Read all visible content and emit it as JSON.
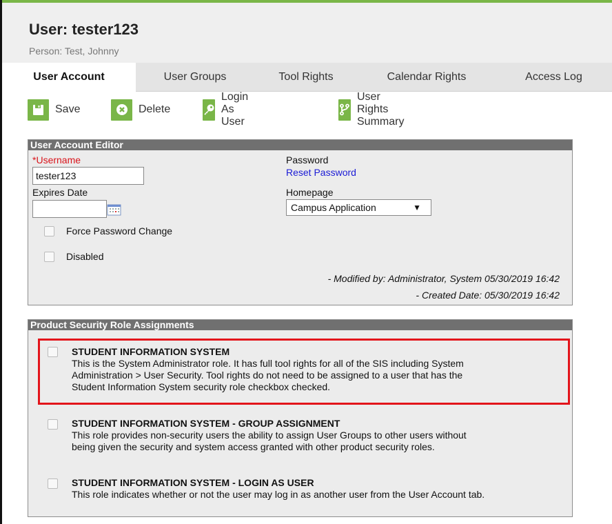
{
  "header": {
    "title": "User: tester123",
    "subtitle": "Person: Test, Johnny"
  },
  "tabs": [
    {
      "label": "User Account",
      "active": true
    },
    {
      "label": "User Groups",
      "active": false
    },
    {
      "label": "Tool Rights",
      "active": false
    },
    {
      "label": "Calendar Rights",
      "active": false
    },
    {
      "label": "Access Log",
      "active": false
    }
  ],
  "toolbar": {
    "save_label": "Save",
    "delete_label": "Delete",
    "login_as_user_label": "Login As User",
    "rights_summary_label": "User Rights Summary"
  },
  "editor": {
    "header": "User Account Editor",
    "username_required_mark": "*",
    "username_label": "Username",
    "username_value": "tester123",
    "expires_label": "Expires Date",
    "expires_value": "",
    "password_label": "Password",
    "reset_password_link": "Reset Password",
    "homepage_label": "Homepage",
    "homepage_value": "Campus Application",
    "homepage_arrow": "▼",
    "force_password_label": "Force Password Change",
    "force_password_checked": false,
    "disabled_label": "Disabled",
    "disabled_checked": false,
    "modified_by": "- Modified by: Administrator, System 05/30/2019 16:42",
    "created_date": "- Created Date: 05/30/2019 16:42"
  },
  "roles": {
    "header": "Product Security Role Assignments",
    "items": [
      {
        "title": "STUDENT INFORMATION SYSTEM",
        "line1": "This is the System Administrator role. It has full tool rights for all of the SIS including System",
        "line2": "Administration > User Security. Tool rights do not need to be assigned to a user that has the",
        "line3": "Student Information System security role checkbox checked.",
        "checked": false
      },
      {
        "title": "STUDENT INFORMATION SYSTEM - GROUP ASSIGNMENT",
        "line1": "This role provides non-security users the ability to assign User Groups to other users without",
        "line2": "being given the security and system access granted with other product security roles.",
        "checked": false
      },
      {
        "title": "STUDENT INFORMATION SYSTEM - LOGIN AS USER",
        "line1": "This role indicates whether or not the user may log in as another user from the User Account tab.",
        "checked": false
      }
    ]
  },
  "colors": {
    "accent_green": "#7ab648",
    "panel_header": "#707070",
    "highlight_red": "#e3141b",
    "link_blue": "#1a1ad6",
    "required_red": "#d9141b"
  }
}
